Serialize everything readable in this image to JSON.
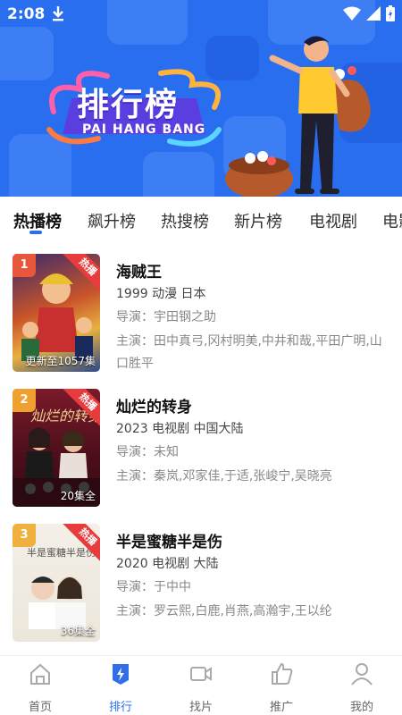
{
  "status_bar": {
    "time": "2:08",
    "icons": [
      "download-icon",
      "wifi-icon",
      "signal-icon",
      "battery-icon"
    ]
  },
  "banner": {
    "title": "排行榜",
    "subtitle": "PAI HANG BANG"
  },
  "tabs": [
    {
      "label": "热播榜",
      "active": true
    },
    {
      "label": "飙升榜",
      "active": false
    },
    {
      "label": "热搜榜",
      "active": false
    },
    {
      "label": "新片榜",
      "active": false
    },
    {
      "label": "电视剧",
      "active": false
    },
    {
      "label": "电影",
      "active": false
    }
  ],
  "items": [
    {
      "rank": "1",
      "rank_color": "#e8563c",
      "badge": "热播",
      "episodes": "更新至1057集",
      "name": "海贼王",
      "meta": "1999  动漫  日本",
      "director": "导演：宇田钢之助",
      "cast": "主演：田中真弓,冈村明美,中井和哉,平田广明,山口胜平"
    },
    {
      "rank": "2",
      "rank_color": "#f0a030",
      "badge": "热播",
      "episodes": "20集全",
      "name": "灿烂的转身",
      "meta": "2023  电视剧  中国大陆",
      "director": "导演：未知",
      "cast": "主演：秦岚,邓家佳,于适,张峻宁,吴晓亮"
    },
    {
      "rank": "3",
      "rank_color": "#f0b040",
      "badge": "热播",
      "episodes": "36集全",
      "name": "半是蜜糖半是伤",
      "meta": "2020  电视剧  大陆",
      "director": "导演：于中中",
      "cast": "主演：罗云熙,白鹿,肖燕,高瀚宇,王以纶"
    }
  ],
  "bottom_nav": [
    {
      "label": "首页",
      "icon": "home-icon",
      "active": false
    },
    {
      "label": "排行",
      "icon": "ranking-icon",
      "active": true
    },
    {
      "label": "找片",
      "icon": "video-camera-icon",
      "active": false
    },
    {
      "label": "推广",
      "icon": "thumbs-up-icon",
      "active": false
    },
    {
      "label": "我的",
      "icon": "user-icon",
      "active": false
    }
  ],
  "colors": {
    "accent": "#2f6fe8",
    "banner": "#2a6ef0",
    "hot": "#e83c3c"
  }
}
